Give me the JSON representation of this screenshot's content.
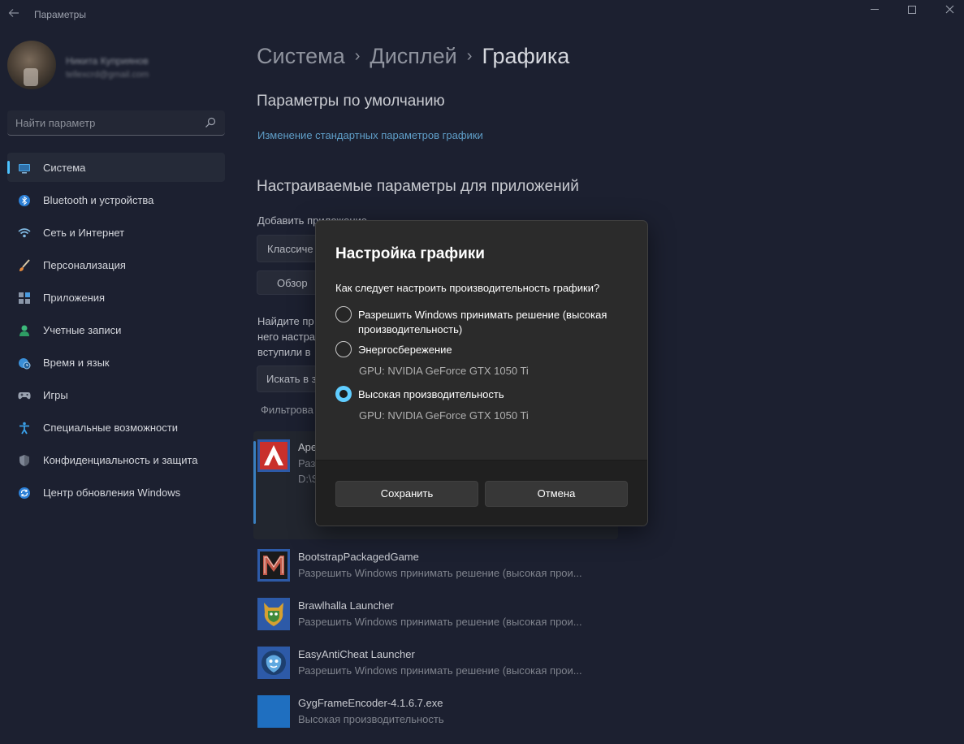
{
  "window": {
    "title": "Параметры"
  },
  "profile": {
    "name": "Никита Куприянов",
    "email": "tellexcrd@gmail.com"
  },
  "search": {
    "placeholder": "Найти параметр"
  },
  "sidebar": {
    "items": [
      {
        "label": "Система",
        "icon": "system-icon",
        "active": true
      },
      {
        "label": "Bluetooth и устройства",
        "icon": "bluetooth-icon"
      },
      {
        "label": "Сеть и Интернет",
        "icon": "network-icon"
      },
      {
        "label": "Персонализация",
        "icon": "brush-icon"
      },
      {
        "label": "Приложения",
        "icon": "apps-icon"
      },
      {
        "label": "Учетные записи",
        "icon": "accounts-icon"
      },
      {
        "label": "Время и язык",
        "icon": "globe-clock-icon"
      },
      {
        "label": "Игры",
        "icon": "gamepad-icon"
      },
      {
        "label": "Специальные возможности",
        "icon": "accessibility-icon"
      },
      {
        "label": "Конфиденциальность и защита",
        "icon": "shield-icon"
      },
      {
        "label": "Центр обновления Windows",
        "icon": "update-icon"
      }
    ]
  },
  "breadcrumb": {
    "part1": "Система",
    "part2": "Дисплей",
    "current": "Графика",
    "separator": "›"
  },
  "main": {
    "defaults_heading": "Параметры по умолчанию",
    "defaults_link": "Изменение стандартных параметров графики",
    "custom_heading": "Настраиваемые параметры для приложений",
    "add_app_label": "Добавить приложение",
    "app_type_value": "Классиче",
    "browse_button": "Обзор",
    "find_text_line1": "Найдите пр",
    "find_text_line2": "него настра",
    "find_text_line3": "вступили в",
    "search_apps_placeholder": "Искать в з",
    "filter_label": "Фильтрова"
  },
  "apps": [
    {
      "name": "Ape",
      "sub": "Раз",
      "path": "D:\\S",
      "icon": "apex-icon"
    },
    {
      "name": "BootstrapPackagedGame",
      "sub": "Разрешить Windows принимать решение (высокая прои...",
      "icon": "bootstrap-game-icon"
    },
    {
      "name": "Brawlhalla Launcher",
      "sub": "Разрешить Windows принимать решение (высокая прои...",
      "icon": "brawlhalla-icon"
    },
    {
      "name": "EasyAntiCheat Launcher",
      "sub": "Разрешить Windows принимать решение (высокая прои...",
      "icon": "easyanticheat-icon"
    },
    {
      "name": "GygFrameEncoder-4.1.6.7.exe",
      "sub": "Высокая производительность",
      "icon": "exe-icon"
    }
  ],
  "dialog": {
    "title": "Настройка графики",
    "question": "Как следует настроить производительность графики?",
    "options": [
      {
        "label_line1": "Разрешить Windows принимать решение (высокая",
        "label_line2": "производительность)",
        "selected": false
      },
      {
        "label": "Энергосбережение",
        "gpu": "GPU: NVIDIA GeForce GTX 1050 Ti",
        "selected": false
      },
      {
        "label": "Высокая производительность",
        "gpu": "GPU: NVIDIA GeForce GTX 1050 Ti",
        "selected": true
      }
    ],
    "save_button": "Сохранить",
    "cancel_button": "Отмена"
  },
  "colors": {
    "accent": "#60cdff",
    "nav_indicator": "#4cc2ff",
    "link": "#5f9ec8",
    "background": "#1c2030"
  }
}
